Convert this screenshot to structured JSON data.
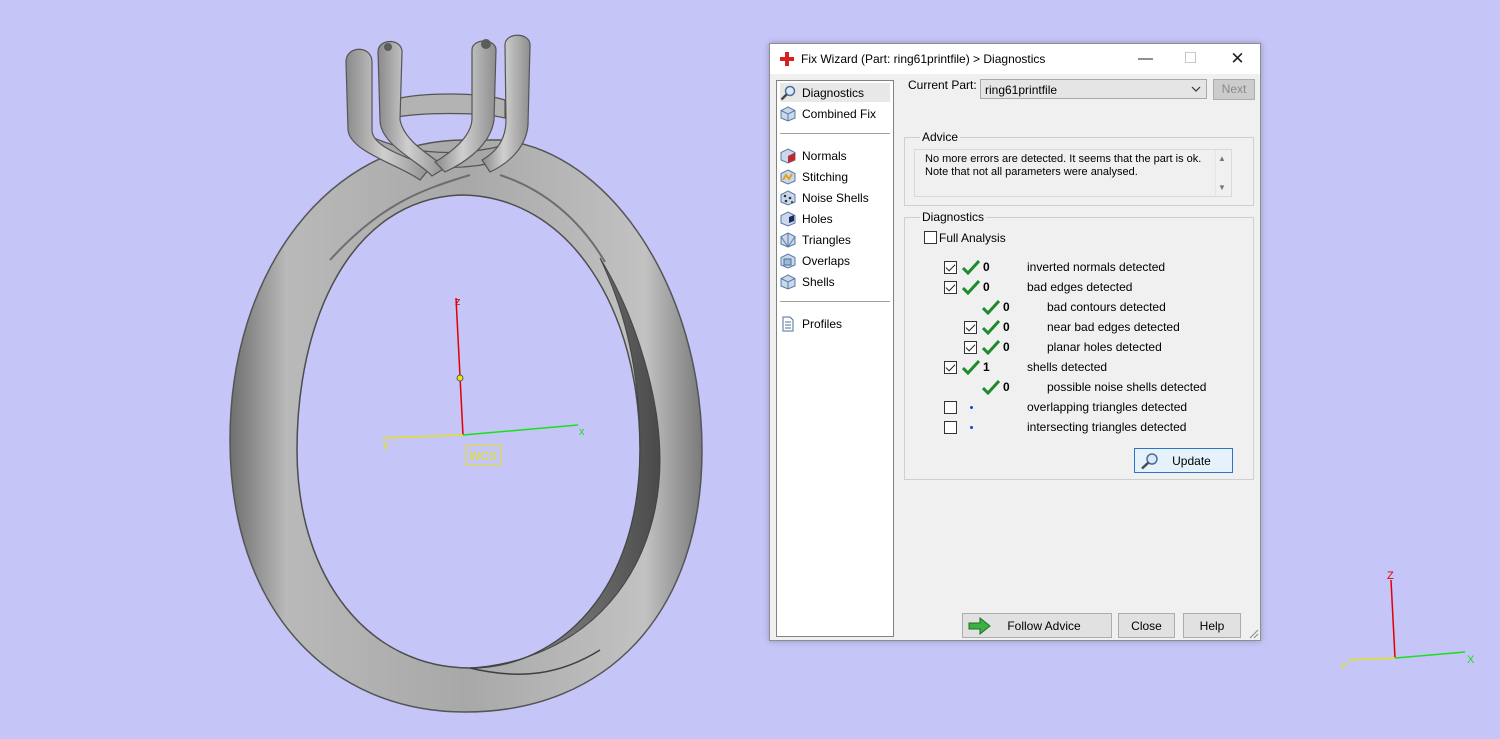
{
  "viewport": {
    "background_color": "#c5c5f7",
    "axes_labels": {
      "z": "z",
      "y": "y",
      "x": "x",
      "wcs": "WCS"
    },
    "mini_axes_labels": {
      "z": "Z",
      "y": "Y",
      "x": "X"
    }
  },
  "dialog": {
    "title": "Fix Wizard (Part: ring61printfile) > Diagnostics",
    "controls": {
      "minimize": "—",
      "maximize": "☐",
      "close": "✕"
    },
    "sidebar": {
      "items": [
        {
          "label": "Diagnostics",
          "icon": "magnifier-icon"
        },
        {
          "label": "Combined Fix",
          "icon": "cube-icon"
        },
        {
          "label": "Normals",
          "icon": "normals-icon"
        },
        {
          "label": "Stitching",
          "icon": "stitching-icon"
        },
        {
          "label": "Noise Shells",
          "icon": "noise-shells-icon"
        },
        {
          "label": "Holes",
          "icon": "holes-icon"
        },
        {
          "label": "Triangles",
          "icon": "triangles-icon"
        },
        {
          "label": "Overlaps",
          "icon": "overlaps-icon"
        },
        {
          "label": "Shells",
          "icon": "shells-icon"
        },
        {
          "label": "Profiles",
          "icon": "profiles-icon"
        }
      ]
    },
    "current_part": {
      "label": "Current Part:",
      "value": "ring61printfile"
    },
    "next_label": "Next",
    "advice": {
      "legend": "Advice",
      "line1": "No more errors are detected. It seems that the part is ok.",
      "line2": "Note that not all parameters were analysed."
    },
    "diagnostics": {
      "legend": "Diagnostics",
      "full_analysis_label": "Full Analysis",
      "full_analysis_checked": false,
      "rows": [
        {
          "checked": true,
          "status": "ok",
          "count": "0",
          "label": "inverted normals detected"
        },
        {
          "checked": true,
          "status": "ok",
          "count": "0",
          "label": "bad edges detected"
        },
        {
          "checked": null,
          "status": "ok",
          "count": "0",
          "label": "bad contours detected"
        },
        {
          "checked": true,
          "status": "ok",
          "count": "0",
          "label": "near bad edges detected"
        },
        {
          "checked": true,
          "status": "ok",
          "count": "0",
          "label": "planar holes detected"
        },
        {
          "checked": true,
          "status": "ok",
          "count": "1",
          "label": "shells detected"
        },
        {
          "checked": null,
          "status": "ok",
          "count": "0",
          "label": "possible noise shells detected"
        },
        {
          "checked": false,
          "status": "pending",
          "count": "",
          "label": "overlapping triangles detected"
        },
        {
          "checked": false,
          "status": "pending",
          "count": "",
          "label": "intersecting triangles detected"
        }
      ],
      "update_label": "Update"
    },
    "buttons": {
      "follow_advice": "Follow Advice",
      "close": "Close",
      "help": "Help"
    }
  }
}
